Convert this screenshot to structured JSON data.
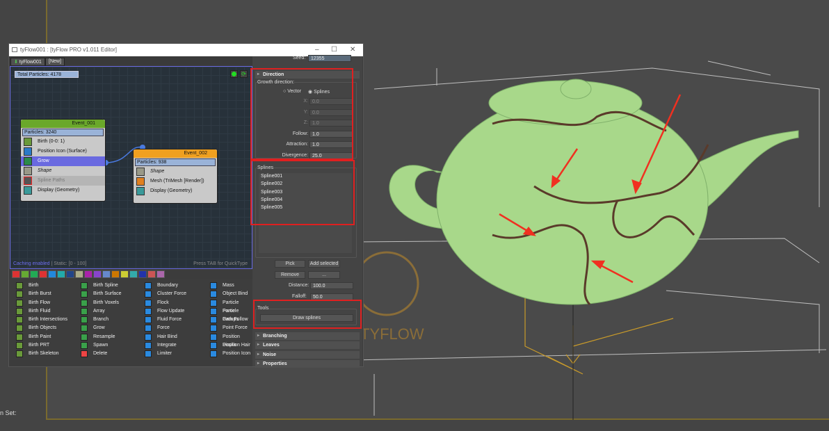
{
  "window": {
    "title": "tyFlow001 : [tyFlow PRO v1.011 Editor]",
    "tabs": [
      "tyFlow001",
      "[New]"
    ]
  },
  "graph": {
    "total_particles": "Total Particles: 4178",
    "caching": "Caching enabled",
    "static": " | Static: [0 - 100]",
    "quicktype": "Press TAB for QuickType",
    "events": [
      {
        "name": "Event_001",
        "particles": "Particles: 3240",
        "ops": [
          "Birth (0-0: 1)",
          "Position Icon (Surface)",
          "Grow",
          "Shape",
          "Spline Paths",
          "Display (Geometry)"
        ]
      },
      {
        "name": "Event_002",
        "particles": "Particles: 938",
        "ops": [
          "Shape",
          "Mesh (TriMesh [Render])",
          "Display (Geometry)"
        ]
      }
    ]
  },
  "operators": [
    [
      "Birth",
      "Birth Burst",
      "Birth Flow",
      "Birth Fluid",
      "Birth Intersections",
      "Birth Objects",
      "Birth Paint",
      "Birth PRT",
      "Birth Skeleton"
    ],
    [
      "Birth Spline",
      "Birth Surface",
      "Birth Voxels",
      "Array",
      "Branch",
      "Grow",
      "Resample",
      "Spawn",
      "Delete"
    ],
    [
      "Boundary",
      "Cluster Force",
      "Flock",
      "Flow Update",
      "Fluid Force",
      "Force",
      "Hair Bind",
      "Integrate",
      "Limiter"
    ],
    [
      "Mass",
      "Object Bind",
      "Particle Force",
      "Particle Groups",
      "Path Follow",
      "Point Force",
      "Position Displa",
      "Position Hair",
      "Position Icon"
    ]
  ],
  "panel": {
    "seed_label": "Seed:",
    "seed": "12355",
    "direction": {
      "title": "Direction",
      "growth": "Growth direction:",
      "vector": "Vector",
      "splines": "Splines",
      "fields": [
        {
          "label": "X:",
          "value": "0.0"
        },
        {
          "label": "Y:",
          "value": "0.0"
        },
        {
          "label": "Z:",
          "value": "1.0"
        },
        {
          "label": "Follow:",
          "value": "1.0"
        },
        {
          "label": "Attraction:",
          "value": "1.0"
        },
        {
          "label": "Divergence:",
          "value": "25.0"
        }
      ]
    },
    "splines": {
      "title": "Splines",
      "items": [
        "Spline001",
        "Spline002",
        "Spline003",
        "Spline004",
        "Spline005"
      ],
      "pick": "Pick",
      "add": "Add selected",
      "remove": "Remove",
      "more": "...",
      "distance_label": "Distance:",
      "distance": "100.0",
      "falloff_label": "Falloff:",
      "falloff": "50.0"
    },
    "tools": {
      "title": "Tools",
      "draw": "Draw splines"
    },
    "rollouts": [
      "Branching",
      "Leaves",
      "Noise",
      "Properties"
    ]
  },
  "viewport": {
    "logo": "TYFLOW",
    "status": "n Set:"
  }
}
